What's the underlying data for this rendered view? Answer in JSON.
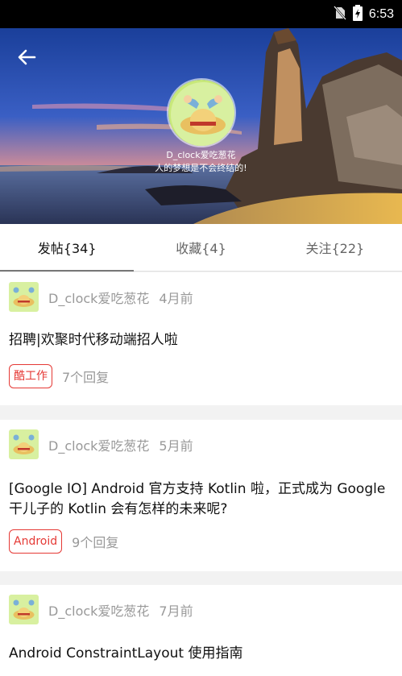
{
  "status_bar": {
    "time": "6:53",
    "icons": [
      "no-sim-icon",
      "battery-charging-icon"
    ]
  },
  "profile": {
    "name": "D_clock爱吃葱花",
    "signature": "人的梦想是不会终结的!"
  },
  "tabs": [
    {
      "label": "发帖{34}",
      "active": true
    },
    {
      "label": "收藏{4}",
      "active": false
    },
    {
      "label": "关注{22}",
      "active": false
    }
  ],
  "posts": [
    {
      "author": "D_clock爱吃葱花",
      "time": "4月前",
      "title": "招聘|欢聚时代移动端招人啦",
      "tag": "酷工作",
      "replies": "7个回复"
    },
    {
      "author": "D_clock爱吃葱花",
      "time": "5月前",
      "title": "[Google IO] Android 官方支持 Kotlin 啦，正式成为 Google 干儿子的 Kotlin 会有怎样的未来呢?",
      "tag": "Android",
      "replies": "9个回复"
    },
    {
      "author": "D_clock爱吃葱花",
      "time": "7月前",
      "title": "Android ConstraintLayout 使用指南"
    }
  ],
  "colors": {
    "tag": "#e53935",
    "muted": "#999999"
  }
}
